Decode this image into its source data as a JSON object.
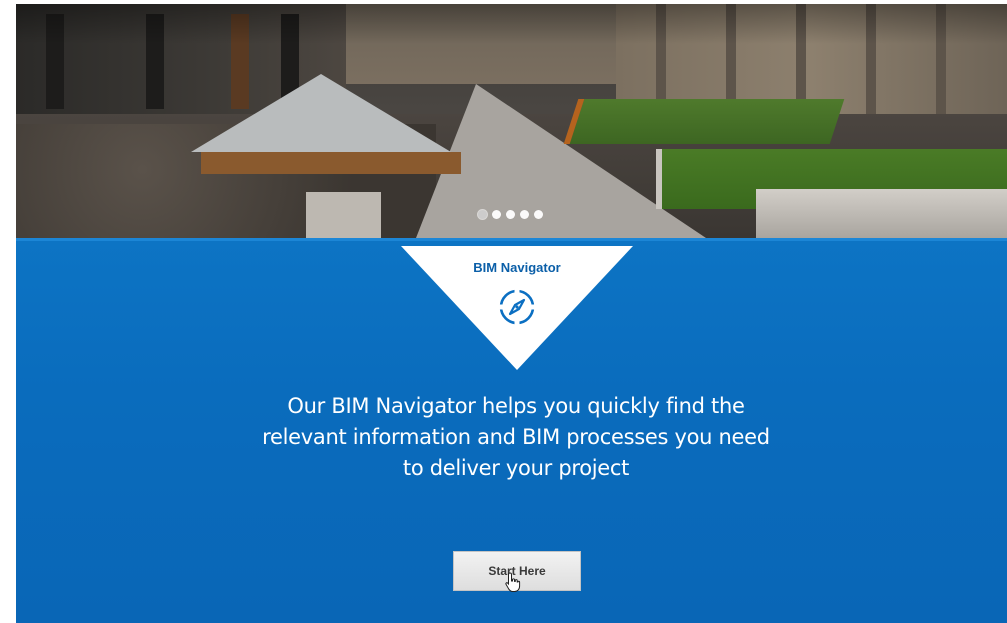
{
  "carousel": {
    "slide_count": 5,
    "active_index": 0
  },
  "feature": {
    "title": "BIM Navigator",
    "icon": "compass-icon",
    "description": "Our BIM Navigator helps you quickly find the relevant information and BIM processes you need to deliver your project",
    "button_label": "Start Here"
  },
  "colors": {
    "panel_blue": "#0a6cbd",
    "title_blue": "#0b5fa8",
    "button_bg": "#e8e8e8"
  }
}
